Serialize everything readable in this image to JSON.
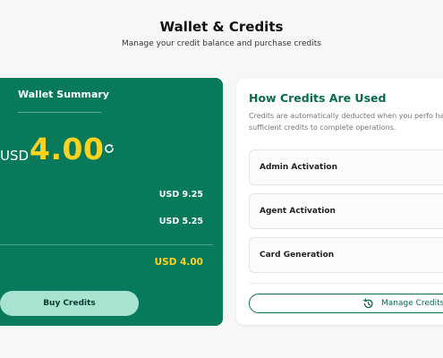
{
  "header": {
    "title": "Wallet & Credits",
    "subtitle": "Manage your credit balance and purchase credits"
  },
  "wallet": {
    "title": "Wallet Summary",
    "currency": "USD",
    "balance": "4.00",
    "refresh_icon": "refresh-icon",
    "items": [
      {
        "label": "",
        "value": "USD 9.25"
      },
      {
        "label": "",
        "value": "USD 5.25"
      }
    ],
    "total": {
      "label": "",
      "value": "USD 4.00"
    },
    "buy_label": "Buy Credits"
  },
  "info": {
    "title": "How Credits Are Used",
    "description": "Credits are automatically deducted when you perfo have sufficient credits to complete operations.",
    "operations": [
      {
        "label": "Admin Activation"
      },
      {
        "label": "Agent Activation"
      },
      {
        "label": "Card Generation"
      }
    ],
    "manage_label": "Manage Credits",
    "manage_icon": "history-icon"
  },
  "colors": {
    "brand": "#067a5a",
    "accent": "#ffd21f",
    "button_light": "#a8e3d2"
  }
}
